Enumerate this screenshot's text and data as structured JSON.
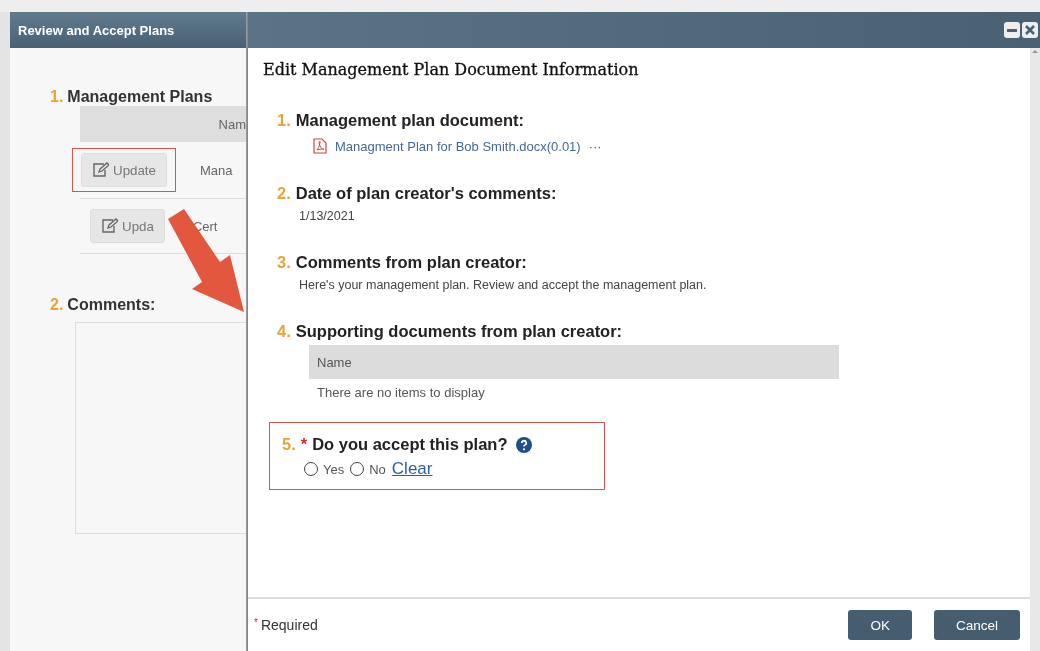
{
  "background_window": {
    "title": "Review and Accept Plans",
    "plans_section": {
      "number": "1.",
      "label": "Management Plans",
      "column": "Nam",
      "rows": [
        {
          "button": "Update",
          "name": "Mana",
          "highlighted": true
        },
        {
          "button": "Upda",
          "name": "Cert",
          "highlighted": false
        }
      ]
    },
    "comments_section": {
      "number": "2.",
      "label": "Comments:"
    }
  },
  "dialog": {
    "title": "Edit Management Plan Document Information",
    "required_mark": "*",
    "questions": [
      {
        "kind": "file",
        "number": "1.",
        "label": "Management plan document:",
        "file": "Managment Plan for Bob Smith.docx(0.01)",
        "more": "···"
      },
      {
        "kind": "text",
        "number": "2.",
        "label": "Date of plan creator's comments:",
        "value": "1/13/2021"
      },
      {
        "kind": "text",
        "number": "3.",
        "label": "Comments from plan creator:",
        "value": "Here's your management plan. Review and accept the management plan."
      },
      {
        "kind": "table",
        "number": "4.",
        "label": "Supporting documents from plan creator:",
        "column": "Name",
        "empty": "There are no items to display"
      },
      {
        "kind": "radio",
        "number": "5.",
        "required": true,
        "highlighted": true,
        "label": "Do you accept this plan?",
        "options": [
          {
            "label": "Yes",
            "selected": false
          },
          {
            "label": "No",
            "selected": false
          }
        ],
        "clear": "Clear"
      }
    ],
    "required_note": "Required",
    "buttons": [
      "OK",
      "Cancel"
    ]
  }
}
